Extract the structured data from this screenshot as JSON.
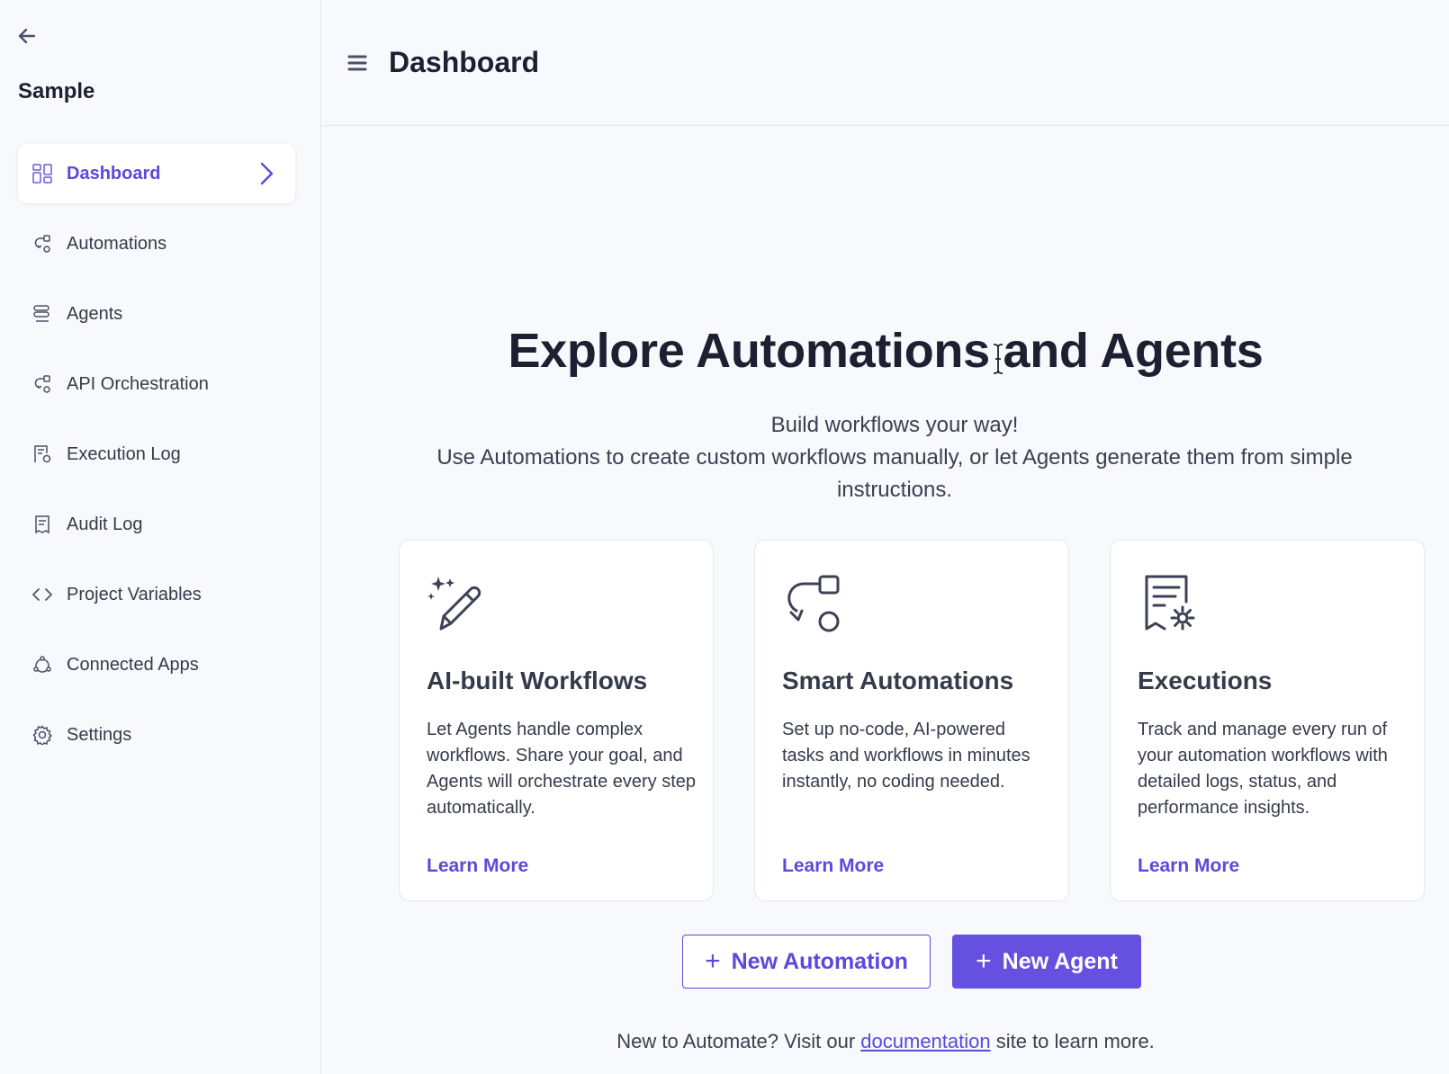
{
  "sidebar": {
    "project_name": "Sample",
    "items": [
      {
        "label": "Dashboard",
        "icon": "dashboard-icon",
        "active": true
      },
      {
        "label": "Automations",
        "icon": "automation-icon"
      },
      {
        "label": "Agents",
        "icon": "agents-icon"
      },
      {
        "label": "API Orchestration",
        "icon": "api-orchestration-icon"
      },
      {
        "label": "Execution Log",
        "icon": "execution-log-icon"
      },
      {
        "label": "Audit Log",
        "icon": "audit-log-icon"
      },
      {
        "label": "Project Variables",
        "icon": "code-icon"
      },
      {
        "label": "Connected Apps",
        "icon": "connected-apps-icon"
      },
      {
        "label": "Settings",
        "icon": "gear-icon"
      }
    ]
  },
  "header": {
    "title": "Dashboard"
  },
  "hero": {
    "title": "Explore Automations and Agents",
    "subtitle_line1": "Build workflows your way!",
    "subtitle_line2": "Use Automations to create custom workflows manually, or let Agents generate them from simple instructions."
  },
  "cards": [
    {
      "title": "AI-built Workflows",
      "desc": "Let Agents handle complex workflows. Share your goal, and Agents will orchestrate every step automatically.",
      "link": "Learn More",
      "icon": "magic-pencil-icon"
    },
    {
      "title": "Smart Automations",
      "desc": "Set up no-code, AI-powered tasks and workflows in minutes instantly, no coding needed.",
      "link": "Learn More",
      "icon": "workflow-icon"
    },
    {
      "title": "Executions",
      "desc": "Track and manage every run of your automation workflows with detailed logs, status, and performance insights.",
      "link": "Learn More",
      "icon": "receipt-gear-icon"
    }
  ],
  "buttons": {
    "new_automation": "New Automation",
    "new_agent": "New Agent",
    "plus": "+"
  },
  "footer": {
    "prefix": "New to Automate? Visit our ",
    "link": "documentation",
    "suffix": " site to learn more."
  },
  "colors": {
    "accent": "#5b49dc",
    "primary_button": "#6550e0",
    "background": "#f8f9fc"
  }
}
